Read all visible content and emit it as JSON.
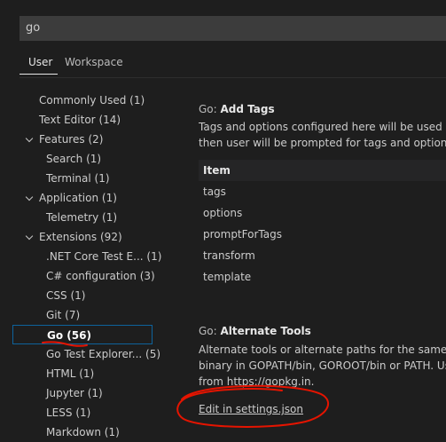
{
  "search": {
    "value": "go"
  },
  "tabs": [
    {
      "label": "User"
    },
    {
      "label": "Workspace"
    }
  ],
  "tree": [
    {
      "label": "Commonly Used",
      "count": "(1)"
    },
    {
      "label": "Text Editor",
      "count": "(14)"
    },
    {
      "label": "Features",
      "count": "(2)"
    },
    {
      "label": "Search",
      "count": "(1)"
    },
    {
      "label": "Terminal",
      "count": "(1)"
    },
    {
      "label": "Application",
      "count": "(1)"
    },
    {
      "label": "Telemetry",
      "count": "(1)"
    },
    {
      "label": "Extensions",
      "count": "(92)"
    },
    {
      "label": ".NET Core Test E...",
      "count": "(1)"
    },
    {
      "label": "C# configuration",
      "count": "(3)"
    },
    {
      "label": "CSS",
      "count": "(1)"
    },
    {
      "label": "Git",
      "count": "(7)"
    },
    {
      "label": "Go",
      "count": "(56)"
    },
    {
      "label": "Go Test Explorer...",
      "count": "(5)"
    },
    {
      "label": "HTML",
      "count": "(1)"
    },
    {
      "label": "Jupyter",
      "count": "(1)"
    },
    {
      "label": "LESS",
      "count": "(1)"
    },
    {
      "label": "Markdown",
      "count": "(1)"
    }
  ],
  "add_tags": {
    "category": "Go: ",
    "name": "Add Tags",
    "desc_line1": "Tags and options configured here will be used by",
    "desc_line2": "then user will be prompted for tags and options.",
    "table_header": "Item",
    "items": [
      "tags",
      "options",
      "promptForTags",
      "transform",
      "template"
    ]
  },
  "alternate_tools": {
    "category": "Go: ",
    "name": "Alternate Tools",
    "desc_line1": "Alternate tools or alternate paths for the same to",
    "desc_line2": "binary in GOPATH/bin, GOROOT/bin or PATH. Us",
    "desc_line3": "from https://gopkg.in.",
    "link": "Edit in settings.json"
  },
  "colors": {
    "background": "#1e1e1e",
    "selection_border": "#0e639c",
    "annotation_red": "#e51400"
  }
}
